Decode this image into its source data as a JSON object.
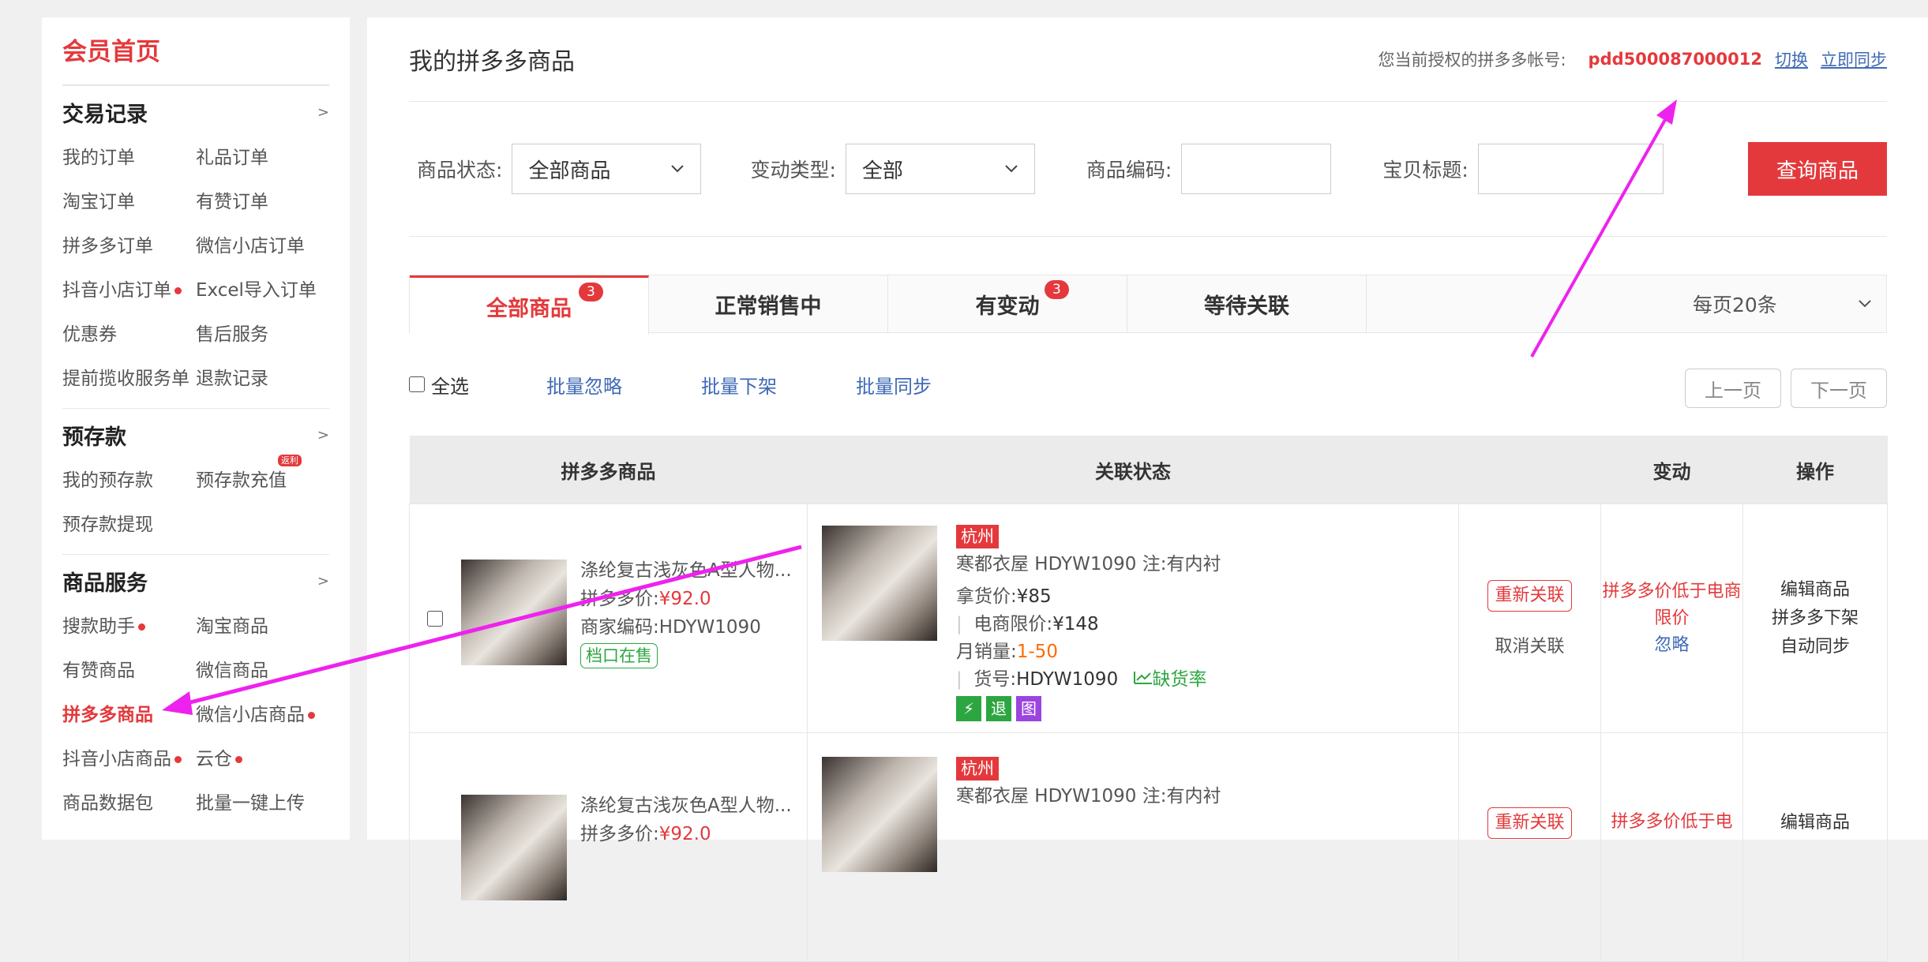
{
  "sidebar": {
    "home": "会员首页",
    "sections": [
      {
        "title": "交易记录",
        "arrow": ">",
        "items": [
          {
            "label": "我的订单"
          },
          {
            "label": "礼品订单"
          },
          {
            "label": "淘宝订单"
          },
          {
            "label": "有赞订单"
          },
          {
            "label": "拼多多订单"
          },
          {
            "label": "微信小店订单"
          },
          {
            "label": "抖音小店订单",
            "dot": true
          },
          {
            "label": "Excel导入订单"
          },
          {
            "label": "优惠券"
          },
          {
            "label": "售后服务"
          },
          {
            "label": "提前揽收服务单"
          },
          {
            "label": "退款记录"
          }
        ]
      },
      {
        "title": "预存款",
        "arrow": ">",
        "items": [
          {
            "label": "我的预存款"
          },
          {
            "label": "预存款充值",
            "badge": "返利"
          },
          {
            "label": "预存款提现"
          }
        ]
      },
      {
        "title": "商品服务",
        "arrow": ">",
        "items": [
          {
            "label": "搜款助手",
            "dot": true
          },
          {
            "label": "淘宝商品"
          },
          {
            "label": "有赞商品"
          },
          {
            "label": "微信商品"
          },
          {
            "label": "拼多多商品",
            "active": true
          },
          {
            "label": "微信小店商品",
            "dot": true
          },
          {
            "label": "抖音小店商品",
            "dot": true
          },
          {
            "label": "云仓",
            "dot": true
          },
          {
            "label": "商品数据包"
          },
          {
            "label": "批量一键上传"
          }
        ]
      }
    ]
  },
  "header": {
    "title": "我的拼多多商品",
    "account_label": "您当前授权的拼多多帐号:",
    "account_id": "pdd500087000012",
    "switch_link": "切换",
    "sync_link": "立即同步"
  },
  "filters": {
    "status_label": "商品状态:",
    "status_value": "全部商品",
    "change_label": "变动类型:",
    "change_value": "全部",
    "code_label": "商品编码:",
    "title_label": "宝贝标题:",
    "query_button": "查询商品"
  },
  "tabs": [
    {
      "label": "全部商品",
      "count": "3",
      "active": true
    },
    {
      "label": "正常销售中"
    },
    {
      "label": "有变动",
      "count": "3"
    },
    {
      "label": "等待关联"
    }
  ],
  "per_page": "每页20条",
  "batch": {
    "select_all": "全选",
    "ignore": "批量忽略",
    "delist": "批量下架",
    "sync": "批量同步",
    "prev": "上一页",
    "next": "下一页"
  },
  "table": {
    "columns": [
      "拼多多商品",
      "关联状态",
      "变动",
      "操作"
    ],
    "rows": [
      {
        "pdd_title": "涤纶复古浅灰色A型人物...",
        "pdd_price_label": "拼多多价:",
        "pdd_price": "¥92.0",
        "pdd_code_label": "商家编码:",
        "pdd_code": "HDYW1090",
        "pdd_status": "档口在售",
        "city": "杭州",
        "link_title": "寒都衣屋 HDYW1090 注:有内衬",
        "cost_label": "拿货价:",
        "cost": "¥85",
        "limit_label": "电商限价:",
        "limit": "¥148",
        "sales_label": "月销量:",
        "sales": "1-50",
        "sku_label": "货号:",
        "sku": "HDYW1090",
        "stockout": "缺货率",
        "icons": [
          "⚡",
          "退",
          "图"
        ],
        "relink": "重新关联",
        "unlink": "取消关联",
        "change": "拼多多价低于电商限价",
        "ignore": "忽略",
        "ops": [
          "编辑商品",
          "拼多多下架",
          "自动同步"
        ]
      },
      {
        "pdd_title": "涤纶复古浅灰色A型人物...",
        "pdd_price_label": "拼多多价:",
        "pdd_price": "¥92.0",
        "city": "杭州",
        "link_title": "寒都衣屋 HDYW1090 注:有内衬",
        "relink": "重新关联",
        "change": "拼多多价低于电",
        "ops": [
          "编辑商品"
        ]
      }
    ]
  },
  "colors": {
    "accent": "#e4393c",
    "link": "#3f6ab5",
    "annotation": "#ee22ee"
  }
}
